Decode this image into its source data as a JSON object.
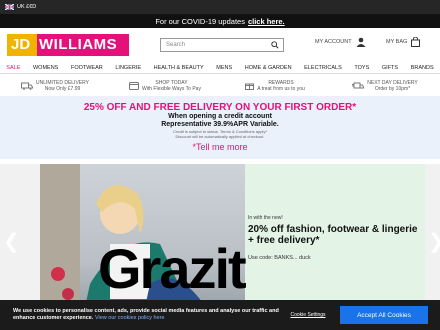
{
  "topbar": {
    "region": "UK £€D"
  },
  "covid": {
    "text": "For our COVID-19 updates",
    "link": "click here."
  },
  "header": {
    "logo_jd": "JD",
    "logo_rest": "WILLIAMS",
    "search_placeholder": "Search",
    "account_label": "MY ACCOUNT",
    "bag_label": "MY BAG"
  },
  "nav": [
    "SALE",
    "WOMENS",
    "FOOTWEAR",
    "LINGERIE",
    "HEALTH & BEAUTY",
    "MENS",
    "HOME & GARDEN",
    "ELECTRICALS",
    "TOYS",
    "GIFTS",
    "BRANDS"
  ],
  "usp": [
    {
      "line1": "UNLIMITED DELIVERY",
      "line2": "Now Only £7.99"
    },
    {
      "line1": "SHOP TODAY",
      "line2": "With Flexible Ways To Pay"
    },
    {
      "line1": "REWARDS",
      "line2": "A treat from us to you"
    },
    {
      "line1": "NEXT DAY DELIVERY",
      "line2": "Order by 10pm*"
    }
  ],
  "promo": {
    "title": "25% OFF AND FREE DELIVERY ON YOUR FIRST ORDER*",
    "sub1": "When opening a credit account",
    "sub2": "Representative 39.9%APR Variable.",
    "small1": "Credit is subject to status. Terms & Conditions apply*",
    "small2": "Discount will be automatically applied at checkout.",
    "link": "*Tell me more"
  },
  "hero": {
    "tag": "In with the new!",
    "headline": "20% off fashion, footwear & lingerie + free delivery*",
    "code": "Use code: BANKS... duck",
    "brand": "Grazit"
  },
  "cookie": {
    "text": "We use cookies to personalise content, ads, provide social media features and analyse our traffic and enhance customer experience.",
    "policy": "View our cookies policy here",
    "settings": "Cookie Settings",
    "accept": "Accept All Cookies"
  },
  "colors": {
    "brand": "#e4117a",
    "accent": "#f0b400",
    "accept": "#1a73e8"
  }
}
